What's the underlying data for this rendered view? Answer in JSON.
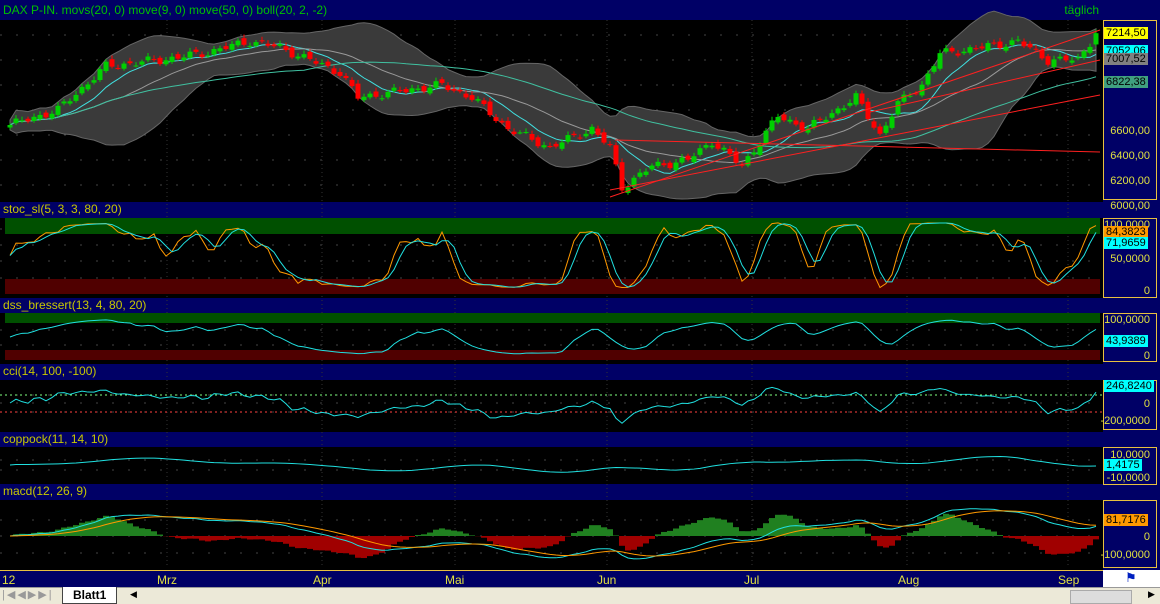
{
  "price_panel": {
    "title": "DAX P-IN. movs(20, 0) move(9, 0) move(50, 0) boll(20, 2, -2)",
    "period": "täglich",
    "axis": [
      "6000,00",
      "6200,00",
      "6400,00",
      "6600,00"
    ],
    "badges": [
      {
        "text": "7214,50",
        "color": "#ffff00"
      },
      {
        "text": "7052,06",
        "color": "#00ffff"
      },
      {
        "text": "7007,52",
        "color": "#808080"
      },
      {
        "text": "6822,38",
        "color": "#40a080"
      }
    ]
  },
  "stoc_panel": {
    "title": "stoc_sl(5, 3, 3, 80, 20)",
    "axis": [
      "100,0000",
      "50,0000",
      "0"
    ],
    "badges": [
      {
        "text": "84,3823",
        "color": "#ff9900"
      },
      {
        "text": "71,9659",
        "color": "#00ffff"
      }
    ]
  },
  "dss_panel": {
    "title": "dss_bressert(13, 4, 80, 20)",
    "axis": [
      "100,0000",
      "0"
    ],
    "badges": [
      {
        "text": "43,9389",
        "color": "#00ffff"
      }
    ]
  },
  "cci_panel": {
    "title": "cci(14, 100, -100)",
    "axis": [
      "0",
      "-200,0000"
    ],
    "badges": [
      {
        "text": "246,8240",
        "color": "#00ffff"
      }
    ]
  },
  "coppock_panel": {
    "title": "coppock(11, 14, 10)",
    "axis": [
      "10,0000",
      "-10,0000"
    ],
    "badges": [
      {
        "text": "1,4175",
        "color": "#00ffff"
      }
    ]
  },
  "macd_panel": {
    "title": "macd(12, 26, 9)",
    "axis": [
      "0",
      "-100,0000"
    ],
    "badges": [
      {
        "text": "81,7176",
        "color": "#ff9900"
      }
    ]
  },
  "x_axis": [
    "12",
    "Mrz",
    "Apr",
    "Mai",
    "Jun",
    "Jul",
    "Aug",
    "Sep"
  ],
  "sheet_tab": "Blatt1",
  "chart_data": {
    "type": "candlestick",
    "title": "DAX P-IN.",
    "ylim": [
      5900,
      7300
    ],
    "keypoints": [
      [
        0,
        6480
      ],
      [
        8,
        6600
      ],
      [
        16,
        6950
      ],
      [
        25,
        7000
      ],
      [
        32,
        7050
      ],
      [
        40,
        7150
      ],
      [
        45,
        7100
      ],
      [
        50,
        7000
      ],
      [
        55,
        6900
      ],
      [
        58,
        6700
      ],
      [
        65,
        6750
      ],
      [
        72,
        6800
      ],
      [
        77,
        6700
      ],
      [
        83,
        6450
      ],
      [
        90,
        6300
      ],
      [
        97,
        6450
      ],
      [
        100,
        6300
      ],
      [
        102,
        5980
      ],
      [
        107,
        6150
      ],
      [
        113,
        6200
      ],
      [
        117,
        6350
      ],
      [
        122,
        6150
      ],
      [
        125,
        6350
      ],
      [
        128,
        6550
      ],
      [
        133,
        6450
      ],
      [
        141,
        6700
      ],
      [
        145,
        6400
      ],
      [
        148,
        6650
      ],
      [
        152,
        6800
      ],
      [
        155,
        7050
      ],
      [
        162,
        7100
      ],
      [
        168,
        7150
      ],
      [
        173,
        7000
      ],
      [
        178,
        7000
      ],
      [
        181,
        7214.5
      ]
    ]
  }
}
